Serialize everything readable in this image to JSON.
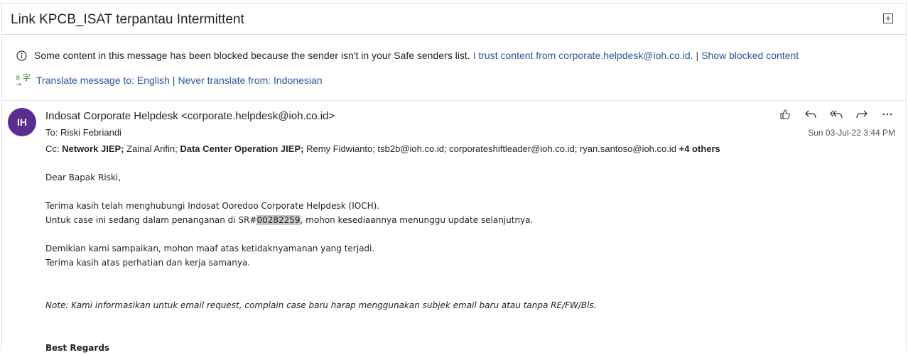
{
  "header": {
    "subject": "Link KPCB_ISAT terpantau Intermittent"
  },
  "infobar": {
    "blocked_text": "Some content in this message has been blocked because the sender isn't in your Safe senders list.",
    "trust_link": "I trust content from corporate.helpdesk@ioh.co.id.",
    "sep": "|",
    "show_blocked": "Show blocked content",
    "translate_link": "Translate message to: English",
    "never_translate": "Never translate from: Indonesian"
  },
  "message": {
    "avatar_initials": "IH",
    "sender": "Indosat Corporate Helpdesk <corporate.helpdesk@ioh.co.id>",
    "to_label": "To:",
    "to": "Riski Febriandi",
    "cc_label": "Cc:",
    "cc": [
      {
        "name": "Network JIEP;",
        "bold": true
      },
      {
        "name": "Zainal Arifin;",
        "bold": false
      },
      {
        "name": "Data Center Operation JIEP;",
        "bold": true
      },
      {
        "name": "Remy Fidwianto;",
        "bold": false
      },
      {
        "name": "tsb2b@ioh.co.id;",
        "bold": false
      },
      {
        "name": "corporateshiftleader@ioh.co.id;",
        "bold": false
      },
      {
        "name": "ryan.santoso@ioh.co.id",
        "bold": false
      }
    ],
    "cc_more": "+4 others",
    "date": "Sun 03-Jul-22 3:44 PM"
  },
  "body": {
    "greeting": "Dear Bapak Riski,",
    "p1": "Terima kasih telah menghubungi Indosat Ooredoo Corporate Helpdesk (IOCH).",
    "p2_pre": "Untuk case ini sedang dalam penanganan di SR#",
    "p2_sr": "00282259",
    "p2_post": ", mohon kesediaannya menunggu update selanjutnya.",
    "p3": "Demikian kami sampaikan, mohon maaf atas ketidaknyamanan yang terjadi.",
    "p4": "Terima kasih atas perhatian dan kerja samanya.",
    "note": "Note: Kami informasikan untuk email request, complain  case baru harap menggunakan subjek email baru atau tanpa RE/FW/Bls.",
    "closing": "Best Regards"
  }
}
